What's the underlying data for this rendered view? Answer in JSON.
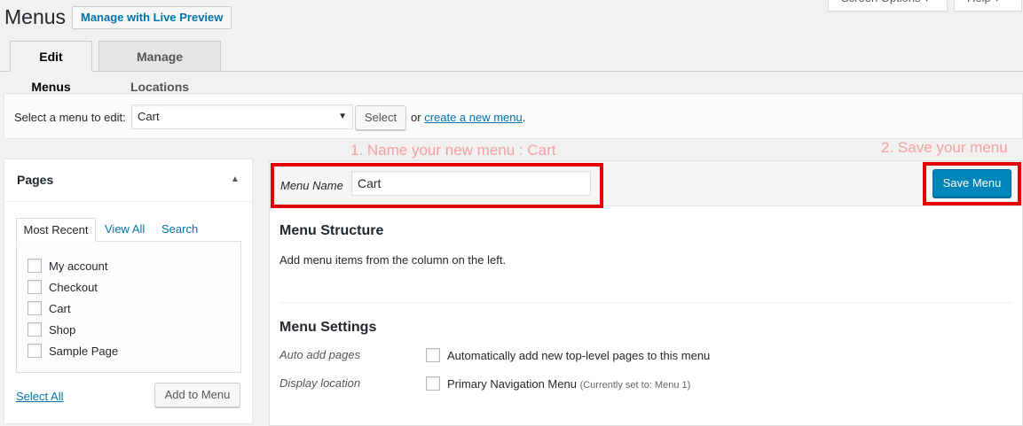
{
  "header": {
    "title": "Menus",
    "live_preview_label": "Manage with Live Preview",
    "screen_options_label": "Screen Options ▾",
    "help_label": "Help ▾"
  },
  "tabs": [
    {
      "label": "Edit Menus",
      "active": true
    },
    {
      "label": "Manage Locations",
      "active": false
    }
  ],
  "select_bar": {
    "label": "Select a menu to edit:",
    "selected_value": "Cart",
    "select_button": "Select",
    "or_text": "or",
    "create_link": "create a new menu",
    "period": "."
  },
  "annotations": {
    "step1": "1. Name your new menu : Cart",
    "step2": "2. Save your menu",
    "color": "#f4a0a0",
    "highlight_color": "#e60000"
  },
  "sidebar": {
    "title": "Pages",
    "tabs": [
      "Most Recent",
      "View All",
      "Search"
    ],
    "items": [
      {
        "label": "My account",
        "checked": false
      },
      {
        "label": "Checkout",
        "checked": false
      },
      {
        "label": "Cart",
        "checked": false
      },
      {
        "label": "Shop",
        "checked": false
      },
      {
        "label": "Sample Page",
        "checked": false
      }
    ],
    "select_all": "Select All",
    "add_button": "Add to Menu"
  },
  "menu_editor": {
    "name_label": "Menu Name",
    "name_value": "Cart",
    "save_button": "Save Menu",
    "structure_title": "Menu Structure",
    "structure_desc": "Add menu items from the column on the left.",
    "settings_title": "Menu Settings",
    "auto_add_label": "Auto add pages",
    "auto_add_option": "Automatically add new top-level pages to this menu",
    "display_location_label": "Display location",
    "display_location_option": "Primary Navigation Menu",
    "display_location_note": "(Currently set to: Menu 1)"
  },
  "colors": {
    "primary_button": "#0085ba",
    "link": "#0073aa"
  }
}
